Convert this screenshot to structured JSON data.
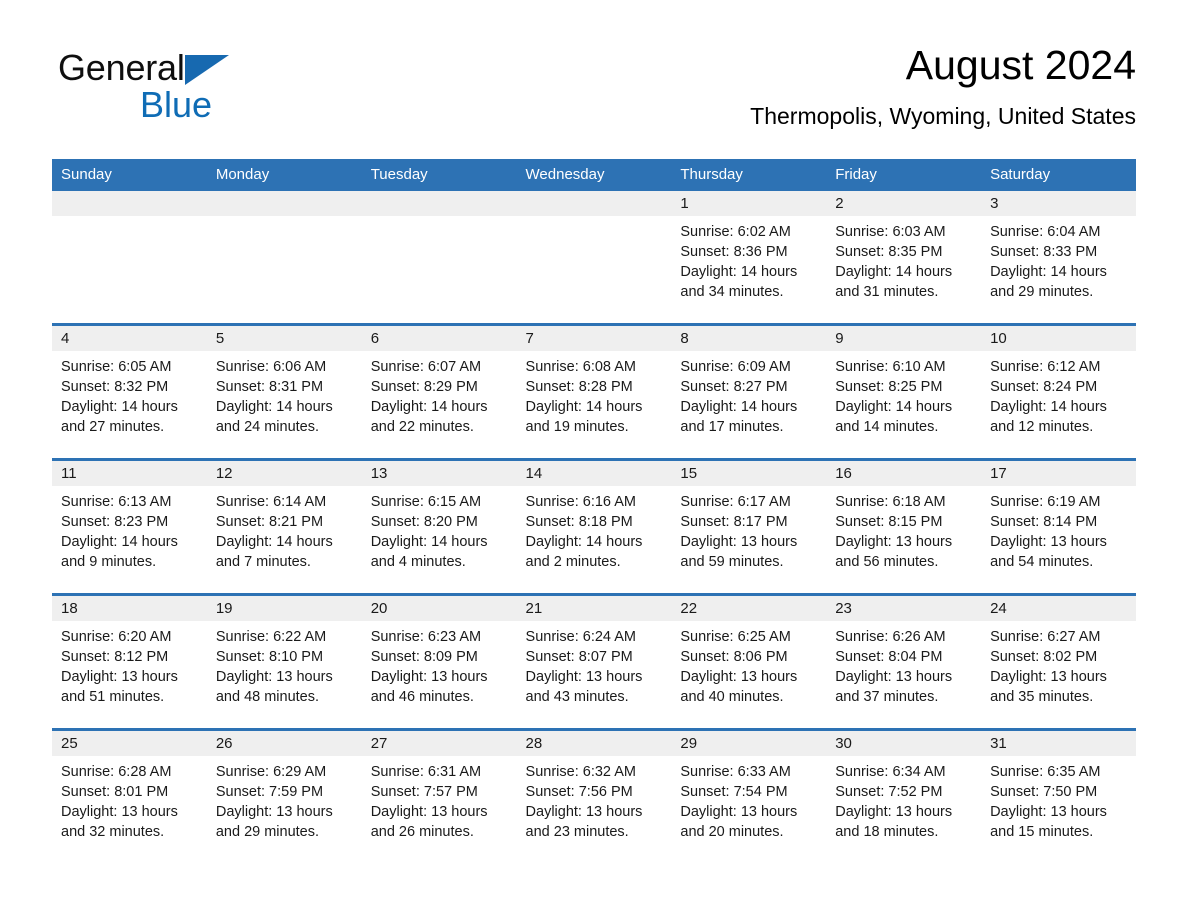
{
  "brand": {
    "word1": "General",
    "word2": "Blue",
    "triangle_color": "#1769b0",
    "blue_color": "#0f6cb5"
  },
  "header": {
    "title": "August 2024",
    "subtitle": "Thermopolis, Wyoming, United States"
  },
  "theme": {
    "header_blue": "#2d72b4",
    "separator_blue": "#2d72b4",
    "daynum_background": "#efefef",
    "cell_background": "#ffffff",
    "text_color": "#1a1a1a"
  },
  "calendar": {
    "weekday_headers": [
      "Sunday",
      "Monday",
      "Tuesday",
      "Wednesday",
      "Thursday",
      "Friday",
      "Saturday"
    ],
    "weeks": [
      [
        {
          "day": "",
          "sunrise": "",
          "sunset": "",
          "daylight": "",
          "empty": true
        },
        {
          "day": "",
          "sunrise": "",
          "sunset": "",
          "daylight": "",
          "empty": true
        },
        {
          "day": "",
          "sunrise": "",
          "sunset": "",
          "daylight": "",
          "empty": true
        },
        {
          "day": "",
          "sunrise": "",
          "sunset": "",
          "daylight": "",
          "empty": true
        },
        {
          "day": "1",
          "sunrise": "Sunrise: 6:02 AM",
          "sunset": "Sunset: 8:36 PM",
          "daylight": "Daylight: 14 hours and 34 minutes."
        },
        {
          "day": "2",
          "sunrise": "Sunrise: 6:03 AM",
          "sunset": "Sunset: 8:35 PM",
          "daylight": "Daylight: 14 hours and 31 minutes."
        },
        {
          "day": "3",
          "sunrise": "Sunrise: 6:04 AM",
          "sunset": "Sunset: 8:33 PM",
          "daylight": "Daylight: 14 hours and 29 minutes."
        }
      ],
      [
        {
          "day": "4",
          "sunrise": "Sunrise: 6:05 AM",
          "sunset": "Sunset: 8:32 PM",
          "daylight": "Daylight: 14 hours and 27 minutes."
        },
        {
          "day": "5",
          "sunrise": "Sunrise: 6:06 AM",
          "sunset": "Sunset: 8:31 PM",
          "daylight": "Daylight: 14 hours and 24 minutes."
        },
        {
          "day": "6",
          "sunrise": "Sunrise: 6:07 AM",
          "sunset": "Sunset: 8:29 PM",
          "daylight": "Daylight: 14 hours and 22 minutes."
        },
        {
          "day": "7",
          "sunrise": "Sunrise: 6:08 AM",
          "sunset": "Sunset: 8:28 PM",
          "daylight": "Daylight: 14 hours and 19 minutes."
        },
        {
          "day": "8",
          "sunrise": "Sunrise: 6:09 AM",
          "sunset": "Sunset: 8:27 PM",
          "daylight": "Daylight: 14 hours and 17 minutes."
        },
        {
          "day": "9",
          "sunrise": "Sunrise: 6:10 AM",
          "sunset": "Sunset: 8:25 PM",
          "daylight": "Daylight: 14 hours and 14 minutes."
        },
        {
          "day": "10",
          "sunrise": "Sunrise: 6:12 AM",
          "sunset": "Sunset: 8:24 PM",
          "daylight": "Daylight: 14 hours and 12 minutes."
        }
      ],
      [
        {
          "day": "11",
          "sunrise": "Sunrise: 6:13 AM",
          "sunset": "Sunset: 8:23 PM",
          "daylight": "Daylight: 14 hours and 9 minutes."
        },
        {
          "day": "12",
          "sunrise": "Sunrise: 6:14 AM",
          "sunset": "Sunset: 8:21 PM",
          "daylight": "Daylight: 14 hours and 7 minutes."
        },
        {
          "day": "13",
          "sunrise": "Sunrise: 6:15 AM",
          "sunset": "Sunset: 8:20 PM",
          "daylight": "Daylight: 14 hours and 4 minutes."
        },
        {
          "day": "14",
          "sunrise": "Sunrise: 6:16 AM",
          "sunset": "Sunset: 8:18 PM",
          "daylight": "Daylight: 14 hours and 2 minutes."
        },
        {
          "day": "15",
          "sunrise": "Sunrise: 6:17 AM",
          "sunset": "Sunset: 8:17 PM",
          "daylight": "Daylight: 13 hours and 59 minutes."
        },
        {
          "day": "16",
          "sunrise": "Sunrise: 6:18 AM",
          "sunset": "Sunset: 8:15 PM",
          "daylight": "Daylight: 13 hours and 56 minutes."
        },
        {
          "day": "17",
          "sunrise": "Sunrise: 6:19 AM",
          "sunset": "Sunset: 8:14 PM",
          "daylight": "Daylight: 13 hours and 54 minutes."
        }
      ],
      [
        {
          "day": "18",
          "sunrise": "Sunrise: 6:20 AM",
          "sunset": "Sunset: 8:12 PM",
          "daylight": "Daylight: 13 hours and 51 minutes."
        },
        {
          "day": "19",
          "sunrise": "Sunrise: 6:22 AM",
          "sunset": "Sunset: 8:10 PM",
          "daylight": "Daylight: 13 hours and 48 minutes."
        },
        {
          "day": "20",
          "sunrise": "Sunrise: 6:23 AM",
          "sunset": "Sunset: 8:09 PM",
          "daylight": "Daylight: 13 hours and 46 minutes."
        },
        {
          "day": "21",
          "sunrise": "Sunrise: 6:24 AM",
          "sunset": "Sunset: 8:07 PM",
          "daylight": "Daylight: 13 hours and 43 minutes."
        },
        {
          "day": "22",
          "sunrise": "Sunrise: 6:25 AM",
          "sunset": "Sunset: 8:06 PM",
          "daylight": "Daylight: 13 hours and 40 minutes."
        },
        {
          "day": "23",
          "sunrise": "Sunrise: 6:26 AM",
          "sunset": "Sunset: 8:04 PM",
          "daylight": "Daylight: 13 hours and 37 minutes."
        },
        {
          "day": "24",
          "sunrise": "Sunrise: 6:27 AM",
          "sunset": "Sunset: 8:02 PM",
          "daylight": "Daylight: 13 hours and 35 minutes."
        }
      ],
      [
        {
          "day": "25",
          "sunrise": "Sunrise: 6:28 AM",
          "sunset": "Sunset: 8:01 PM",
          "daylight": "Daylight: 13 hours and 32 minutes."
        },
        {
          "day": "26",
          "sunrise": "Sunrise: 6:29 AM",
          "sunset": "Sunset: 7:59 PM",
          "daylight": "Daylight: 13 hours and 29 minutes."
        },
        {
          "day": "27",
          "sunrise": "Sunrise: 6:31 AM",
          "sunset": "Sunset: 7:57 PM",
          "daylight": "Daylight: 13 hours and 26 minutes."
        },
        {
          "day": "28",
          "sunrise": "Sunrise: 6:32 AM",
          "sunset": "Sunset: 7:56 PM",
          "daylight": "Daylight: 13 hours and 23 minutes."
        },
        {
          "day": "29",
          "sunrise": "Sunrise: 6:33 AM",
          "sunset": "Sunset: 7:54 PM",
          "daylight": "Daylight: 13 hours and 20 minutes."
        },
        {
          "day": "30",
          "sunrise": "Sunrise: 6:34 AM",
          "sunset": "Sunset: 7:52 PM",
          "daylight": "Daylight: 13 hours and 18 minutes."
        },
        {
          "day": "31",
          "sunrise": "Sunrise: 6:35 AM",
          "sunset": "Sunset: 7:50 PM",
          "daylight": "Daylight: 13 hours and 15 minutes."
        }
      ]
    ]
  }
}
